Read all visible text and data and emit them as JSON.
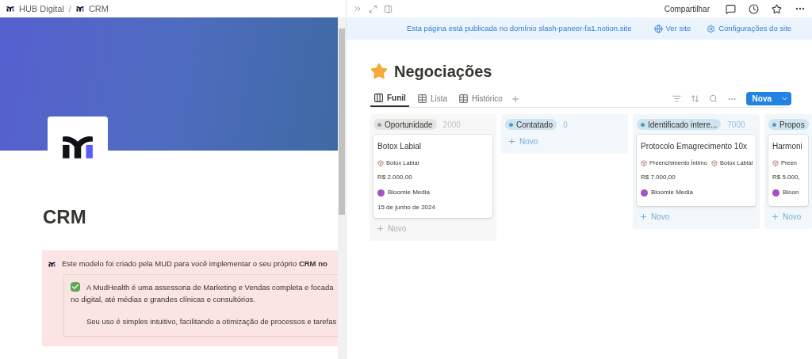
{
  "left_pane": {
    "breadcrumb": [
      "HUB Digital",
      "CRM"
    ],
    "separator": "/",
    "page_title": "CRM",
    "callout": {
      "text": "Este modelo foi criado pela MUD para você implementar o seu próprio **CRM no**",
      "todo": {
        "checked": true,
        "lines": [
          "A MudHealth é uma assessoria de Marketing e Vendas completa e focada",
          "no digital, até médias e grandes clínicas e consultórios."
        ]
      },
      "note": "Seu uso é simples intuitivo, facilitando a otimização de processos e tarefas"
    }
  },
  "right_pane": {
    "topbar": {
      "share": "Compartilhar"
    },
    "banner": {
      "message": "Esta página está publicada no domínio slash-paneer-fa1.notion.site",
      "links": [
        {
          "kind": "globe",
          "label": "Ver site"
        },
        {
          "kind": "gear",
          "label": "Configurações do site"
        }
      ]
    },
    "title": "Negociações",
    "views": [
      {
        "label": "Funil",
        "kind": "board",
        "selected": true
      },
      {
        "label": "Lista",
        "kind": "table",
        "selected": false
      },
      {
        "label": "Histórico",
        "kind": "table",
        "selected": false
      }
    ],
    "new_button": "Nova",
    "board": [
      {
        "name": "Oportunidade",
        "count": "2000",
        "color": "#9b9a97",
        "cards": [
          {
            "title": "Botox Labial",
            "tags": [
              "Botox Labial"
            ],
            "price": "R$ 2.000,00",
            "owner": "Bloomie Media",
            "date": "15 de junho de 2024"
          }
        ],
        "add": "Novo"
      },
      {
        "name": "Contatado",
        "count": "0",
        "color": "#529cca",
        "add": "Novo"
      },
      {
        "name": "Identificado intere...",
        "count": "7000",
        "color": "#529cca",
        "cards": [
          {
            "title": "Protocolo Emagrecimento 10x",
            "tags": [
              "Preenchimento Íntimo",
              "Botox Labial"
            ],
            "price": "R$ 7.000,00",
            "owner": "Bloomie Media"
          }
        ],
        "add": "Novo"
      },
      {
        "name": "Propos",
        "color": "#529cca",
        "cards": [
          {
            "title": "Harmoni",
            "tags": [
              "Preen"
            ],
            "price": "R$ 5.000,",
            "owner": "Bloon"
          }
        ],
        "add": "Novo"
      }
    ]
  }
}
